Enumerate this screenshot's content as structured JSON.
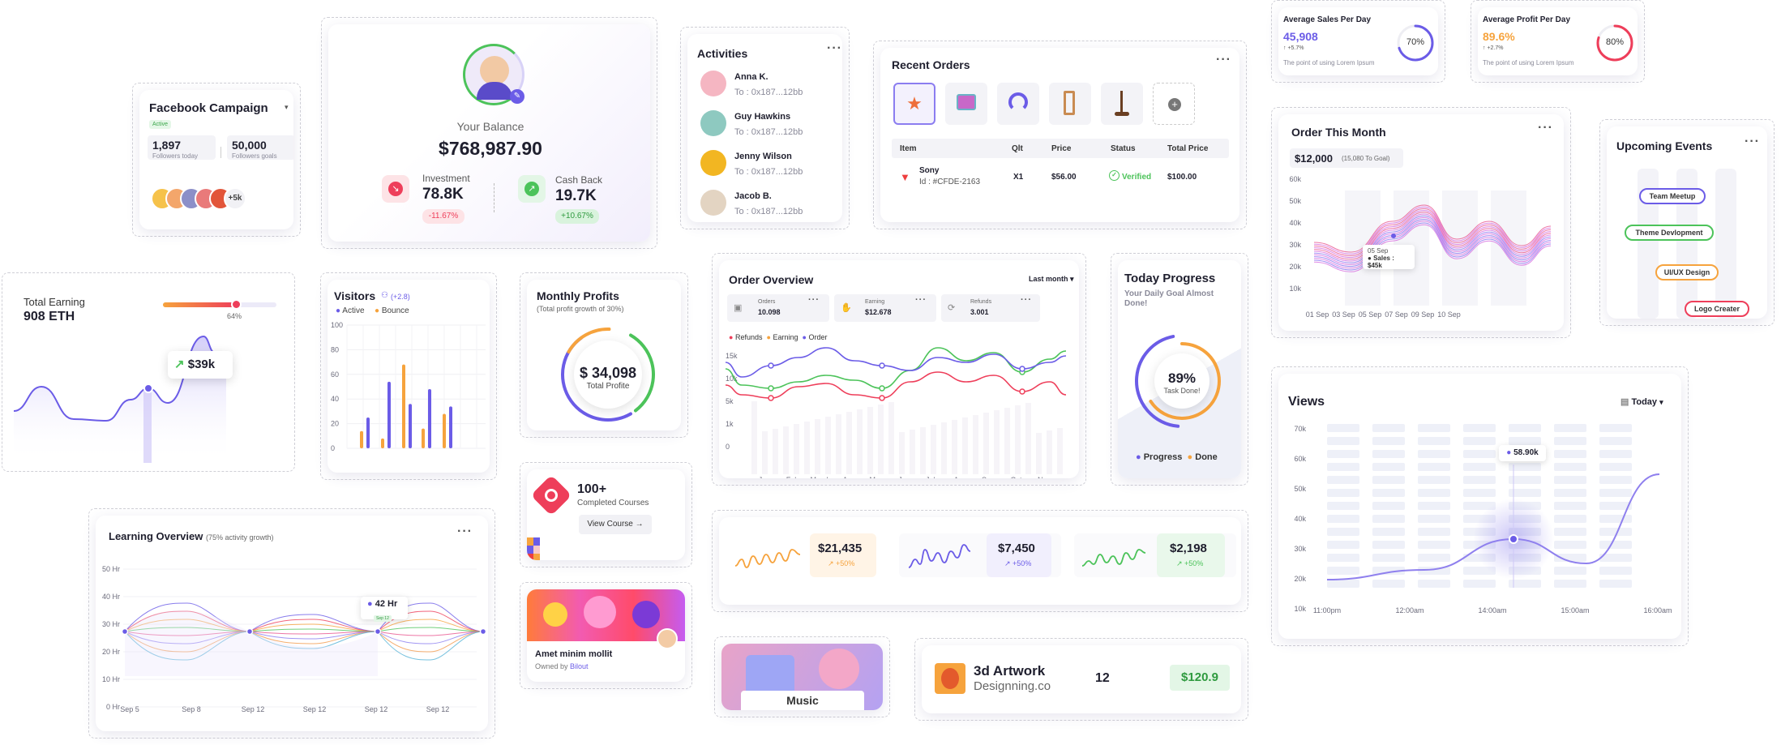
{
  "colors": {
    "purple": "#6b5ce7",
    "orange": "#f6a33d",
    "green": "#4cc35a",
    "red": "#ee3e5a",
    "pink": "#e8548f"
  },
  "facebook": {
    "title": "Facebook Campaign",
    "status": "Active",
    "followers": "1,897",
    "followers_label": "Followers today",
    "goal": "50,000",
    "goal_label": "Followers goals",
    "more": "+5k"
  },
  "balance": {
    "label": "Your Balance",
    "amount": "$768,987.90",
    "investment_label": "Investment",
    "investment_value": "78.8K",
    "investment_change": "-11.67%",
    "cashback_label": "Cash Back",
    "cashback_value": "19.7K",
    "cashback_change": "+10.67%"
  },
  "activities": {
    "title": "Activities",
    "items": [
      {
        "name": "Anna K.",
        "addr": "To : 0x187...12bb"
      },
      {
        "name": "Guy Hawkins",
        "addr": "To : 0x187...12bb"
      },
      {
        "name": "Jenny Wilson",
        "addr": "To : 0x187...12bb"
      },
      {
        "name": "Jacob B.",
        "addr": "To : 0x187...12bb"
      }
    ]
  },
  "orders": {
    "title": "Recent Orders",
    "cols": [
      "Item",
      "Qlt",
      "Price",
      "Status",
      "Total Price"
    ],
    "row": {
      "name": "Sony",
      "id": "Id : #CFDE-2163",
      "qty": "X1",
      "price": "$56.00",
      "status": "Verified",
      "total": "$100.00"
    },
    "add_icon": "plus-icon"
  },
  "avg_sales": {
    "title": "Average Sales Per Day",
    "value": "45,908",
    "change": "+5.7%",
    "note": "The point of using Lorem Ipsum",
    "percent": "70%",
    "ratio": 0.7
  },
  "avg_profit": {
    "title": "Average Profit Per Day",
    "value": "89.6%",
    "change": "+2.7%",
    "note": "The point of using Lorem Ipsum",
    "percent": "80%",
    "ratio": 0.8
  },
  "order_month": {
    "title": "Order This Month",
    "amount": "$12,000",
    "amount_note": "(15,080 To Goal)",
    "tooltip_date": "05 Sep",
    "tooltip_value": "Sales : $45k",
    "y": [
      "60k",
      "50k",
      "40k",
      "30k",
      "20k",
      "10k"
    ],
    "x": [
      "01 Sep",
      "03 Sep",
      "05 Sep",
      "07 Sep",
      "09 Sep",
      "10 Sep"
    ]
  },
  "events": {
    "title": "Upcoming Events",
    "items": [
      {
        "label": "Team Meetup",
        "color": "#6b5ce7"
      },
      {
        "label": "Theme Devlopment",
        "color": "#4cc35a"
      },
      {
        "label": "UI/UX Design",
        "color": "#f6a33d"
      },
      {
        "label": "Logo Creater",
        "color": "#ee3e5a"
      }
    ]
  },
  "earning": {
    "title": "Total Earning",
    "value": "908 ETH",
    "progress": "64%",
    "ratio": 0.64,
    "tooltip": "$39k"
  },
  "visitors": {
    "title": "Visitors",
    "change": "(+2.8)",
    "legend": [
      "Active",
      "Bounce"
    ],
    "y": [
      "100",
      "80",
      "60",
      "40",
      "20",
      "0"
    ]
  },
  "monthly": {
    "title": "Monthly Profits",
    "subtitle": "(Total profit growth of 30%)",
    "value": "$ 34,098",
    "label": "Total Profite"
  },
  "overview": {
    "title": "Order Overview",
    "period": "Last month",
    "stats": [
      {
        "label": "Orders",
        "value": "10.098"
      },
      {
        "label": "Earning",
        "value": "$12.678"
      },
      {
        "label": "Refunds",
        "value": "3.001"
      }
    ],
    "legend": [
      "Refunds",
      "Earning",
      "Order"
    ],
    "y": [
      "15k",
      "10k",
      "5k",
      "1k",
      "0"
    ],
    "x": [
      "Jan",
      "Feb",
      "March",
      "Apr",
      "May",
      "Jun",
      "July",
      "Aug",
      "Sep",
      "Oct",
      "Nov"
    ]
  },
  "today": {
    "title": "Today Progress",
    "subtitle": "Your Daily Goal Almost Done!",
    "value": "89%",
    "label": "Task Done!",
    "legend": [
      "Progress",
      "Done"
    ]
  },
  "views": {
    "title": "Views",
    "period": "Today",
    "tooltip": "58.90k",
    "y": [
      "70k",
      "60k",
      "50k",
      "40k",
      "30k",
      "20k",
      "10k"
    ],
    "x": [
      "11:00pm",
      "12:00am",
      "14:00am",
      "15:00am",
      "16:00am"
    ]
  },
  "learning": {
    "title": "Learning Overview",
    "subtitle": "(75% activity growth)",
    "tooltip": "42 Hr",
    "tooltip_badge": "Sep 12",
    "y": [
      "50 Hr",
      "40 Hr",
      "30 Hr",
      "20 Hr",
      "10 Hr",
      "0 Hr"
    ],
    "x": [
      "Sep 5",
      "Sep 8",
      "Sep 12",
      "Sep 12",
      "Sep 12",
      "Sep 12"
    ]
  },
  "courses": {
    "value": "100+",
    "label": "Completed Courses",
    "button": "View Course"
  },
  "nft": {
    "title": "Amet minim mollit",
    "owner_prefix": "Owned by",
    "owner": "Bilout"
  },
  "music": {
    "label": "Music"
  },
  "minis": [
    {
      "value": "$21,435",
      "change": "+50%",
      "color": "#f6a33d",
      "bg": "#fff4e6"
    },
    {
      "value": "$7,450",
      "change": "+50%",
      "color": "#6b5ce7",
      "bg": "#f1effd"
    },
    {
      "value": "$2,198",
      "change": "+50%",
      "color": "#4cc35a",
      "bg": "#e9f8eb"
    }
  ],
  "artwork": {
    "title": "3d Artwork",
    "subtitle": "Designning.co",
    "count": "12",
    "price": "$120.9"
  }
}
